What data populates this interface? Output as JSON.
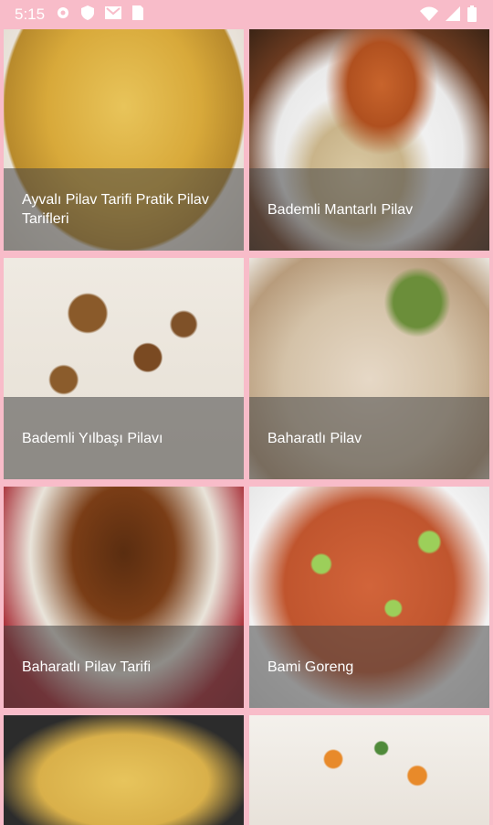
{
  "status_bar": {
    "time": "5:15",
    "icons": [
      "gear-icon",
      "shield-icon",
      "gmail-icon",
      "sim-card-icon"
    ],
    "right_icons": [
      "wifi-icon",
      "signal-icon",
      "battery-icon"
    ]
  },
  "recipes": [
    {
      "title": "Ayvalı Pilav Tarifi Pratik Pilav Tarifleri"
    },
    {
      "title": "Bademli Mantarlı Pilav"
    },
    {
      "title": "Bademli Yılbaşı Pilavı"
    },
    {
      "title": "Baharatlı Pilav"
    },
    {
      "title": "Baharatlı Pilav Tarifi"
    },
    {
      "title": "Bami Goreng"
    }
  ],
  "colors": {
    "accent": "#f8bcc9",
    "caption_overlay": "rgba(70,70,70,0.55)"
  }
}
